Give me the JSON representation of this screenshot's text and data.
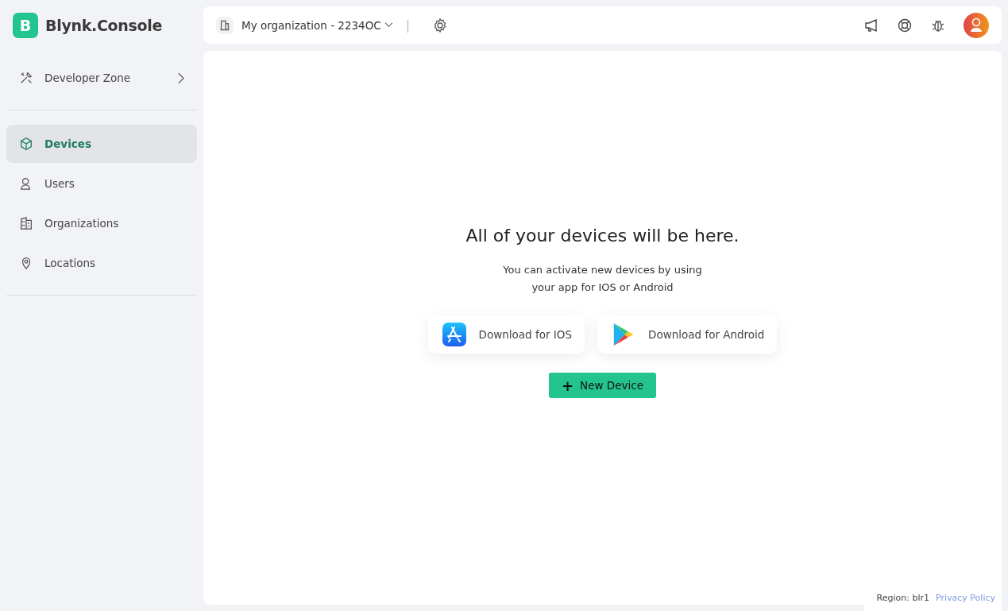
{
  "brand": {
    "logo_letter": "B",
    "name": "Blynk.Console"
  },
  "sidebar": {
    "developer_zone": {
      "label": "Developer Zone"
    },
    "items": [
      {
        "label": "Devices",
        "selected": true
      },
      {
        "label": "Users",
        "selected": false
      },
      {
        "label": "Organizations",
        "selected": false
      },
      {
        "label": "Locations",
        "selected": false
      }
    ]
  },
  "topbar": {
    "organization": "My organization - 2234OC",
    "separator": "|"
  },
  "empty_state": {
    "title": "All of your devices will be here.",
    "text_lines": [
      "You can activate new devices by using",
      "your app for IOS or Android"
    ],
    "store_buttons": [
      {
        "kind": "ios",
        "label": "Download for IOS"
      },
      {
        "kind": "android",
        "label": "Download for Android"
      }
    ],
    "new_device": {
      "icon": "+",
      "label": "New Device"
    }
  },
  "footer": {
    "region": "Region: blr1",
    "privacy": "Privacy Policy"
  }
}
